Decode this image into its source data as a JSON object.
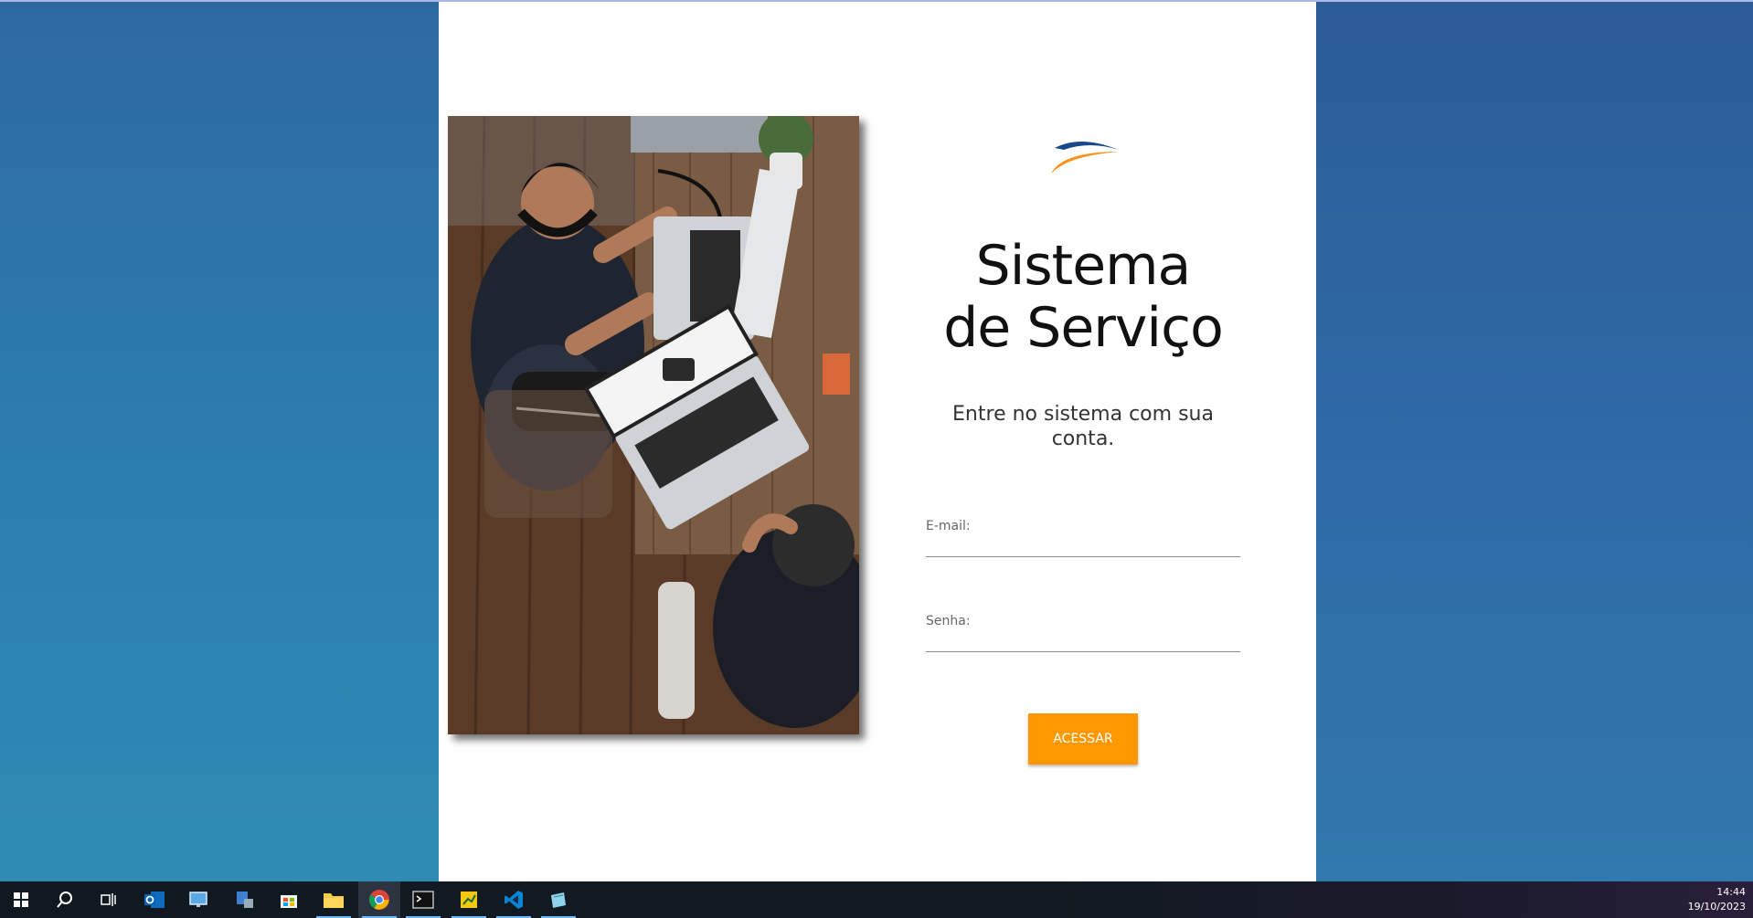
{
  "app": {
    "title": "Sistema de Serviço",
    "subtitle": "Entre no sistema com sua conta.",
    "email_label": "E-mail:",
    "email_value": "",
    "senha_label": "Senha:",
    "senha_value": "",
    "submit_label": "ACESSAR",
    "accent_color": "#ff9800"
  },
  "taskbar": {
    "items": [
      {
        "name": "windows-start-icon"
      },
      {
        "name": "search-icon"
      },
      {
        "name": "task-view-icon"
      },
      {
        "name": "outlook-icon"
      },
      {
        "name": "remote-desktop-icon"
      },
      {
        "name": "network-admin-icon"
      },
      {
        "name": "microsoft-store-icon"
      },
      {
        "name": "file-explorer-icon"
      },
      {
        "name": "chrome-icon",
        "active": true
      },
      {
        "name": "terminal-icon"
      },
      {
        "name": "power-bi-icon"
      },
      {
        "name": "vscode-icon"
      },
      {
        "name": "notes-icon"
      }
    ],
    "time": "14:44",
    "date": "19/10/2023"
  }
}
